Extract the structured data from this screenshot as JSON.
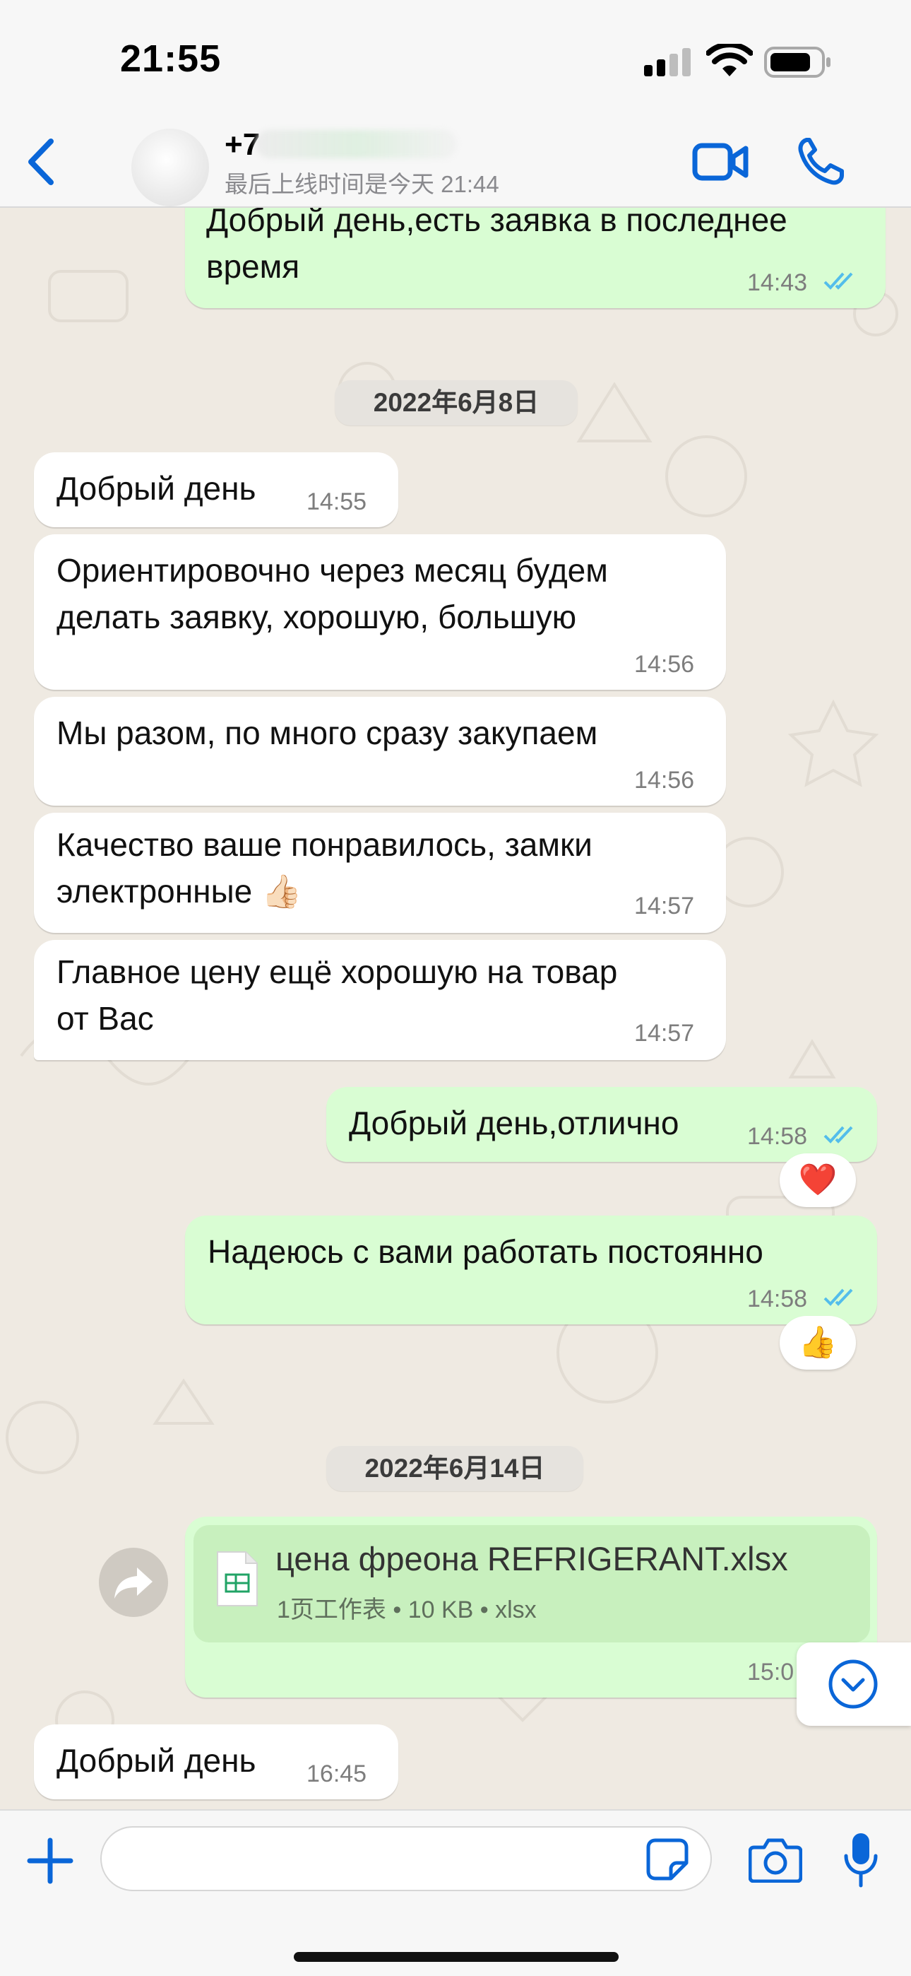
{
  "status_bar": {
    "time": "21:55"
  },
  "header": {
    "contact_name": "+7",
    "contact_name_overlay": "最后",
    "last_seen": "最后上线时间是今天 21:44",
    "back_icon": "chevron-left-icon",
    "video_icon": "video-camera-icon",
    "call_icon": "phone-icon"
  },
  "colors": {
    "accent": "#0a66d8",
    "outgoing_bubble": "#d9fdd3",
    "incoming_bubble": "#ffffff",
    "chat_background": "#efeae2",
    "read_ticks": "#53bdeb"
  },
  "messages": [
    {
      "direction": "out",
      "text_lines": [
        "Добрый день,есть заявка в последнее",
        "время"
      ],
      "time": "14:43",
      "read": true
    },
    {
      "type": "date",
      "text": "2022年6月8日"
    },
    {
      "direction": "in",
      "text_lines": [
        "Добрый день"
      ],
      "time": "14:55"
    },
    {
      "direction": "in",
      "text_lines": [
        "Ориентировочно через месяц будем",
        "делать заявку, хорошую, большую"
      ],
      "time": "14:56"
    },
    {
      "direction": "in",
      "text_lines": [
        "Мы разом, по много сразу закупаем"
      ],
      "time": "14:56"
    },
    {
      "direction": "in",
      "text_lines": [
        "Качество ваше понравилось, замки",
        "электронные 👍🏻"
      ],
      "time": "14:57"
    },
    {
      "direction": "in",
      "text_lines": [
        "Главное цену ещё хорошую на товар",
        "от Вас"
      ],
      "time": "14:57"
    },
    {
      "direction": "out",
      "text_lines": [
        "Добрый день,отлично"
      ],
      "time": "14:58",
      "read": true,
      "reaction": "❤️"
    },
    {
      "direction": "out",
      "text_lines": [
        "Надеюсь с вами работать постоянно"
      ],
      "time": "14:58",
      "read": true,
      "reaction": "👍"
    },
    {
      "type": "date",
      "text": "2022年6月14日"
    },
    {
      "direction": "out",
      "type": "file",
      "file_name": "цена фреона REFRIGERANT.xlsx",
      "file_meta": "1页工作表 • 10 KB • xlsx",
      "time": "15:0",
      "file_icon": "spreadsheet-icon"
    },
    {
      "direction": "in",
      "text_lines": [
        "Добрый день"
      ],
      "time": "16:45"
    }
  ],
  "input_bar": {
    "placeholder": "",
    "plus_icon": "plus-icon",
    "sticker_icon": "sticker-icon",
    "camera_icon": "camera-icon",
    "mic_icon": "microphone-icon"
  },
  "scroll_down_icon": "chevron-down-circle-icon",
  "forward_icon": "forward-arrow-icon"
}
